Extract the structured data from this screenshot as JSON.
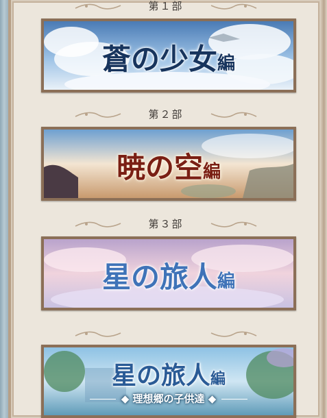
{
  "parts": [
    {
      "label": "第１部",
      "title_main": "蒼の少女",
      "title_suffix": "編",
      "subtitle": "",
      "colors": {
        "sky_top": "#4a7bb5",
        "sky_mid": "#9ec3e6",
        "sky_low": "#e9f1f8",
        "text": "#17345d",
        "stroke": "#ffffff"
      }
    },
    {
      "label": "第２部",
      "title_main": "暁の空",
      "title_suffix": "編",
      "subtitle": "",
      "colors": {
        "sky_top": "#6ea0d1",
        "sky_mid": "#f3e5d2",
        "sky_low": "#c89a6e",
        "text": "#7a1f14",
        "stroke": "#fff6e4"
      }
    },
    {
      "label": "第３部",
      "title_main": "星の旅人",
      "title_suffix": "編",
      "subtitle": "",
      "colors": {
        "sky_top": "#b9a3cc",
        "sky_mid": "#f0d3dd",
        "sky_low": "#c9c2e2",
        "text": "#3f73b8",
        "stroke": "#ffffff"
      }
    },
    {
      "label": "",
      "title_main": "星の旅人",
      "title_suffix": "編",
      "subtitle": "理想郷の子供達",
      "colors": {
        "sky_top": "#8ec2e4",
        "sky_mid": "#cfe6f3",
        "sky_low": "#5f9bb8",
        "text": "#2a5b96",
        "stroke": "#ffffff",
        "subtitle_bg": "#2c5d80"
      }
    }
  ]
}
